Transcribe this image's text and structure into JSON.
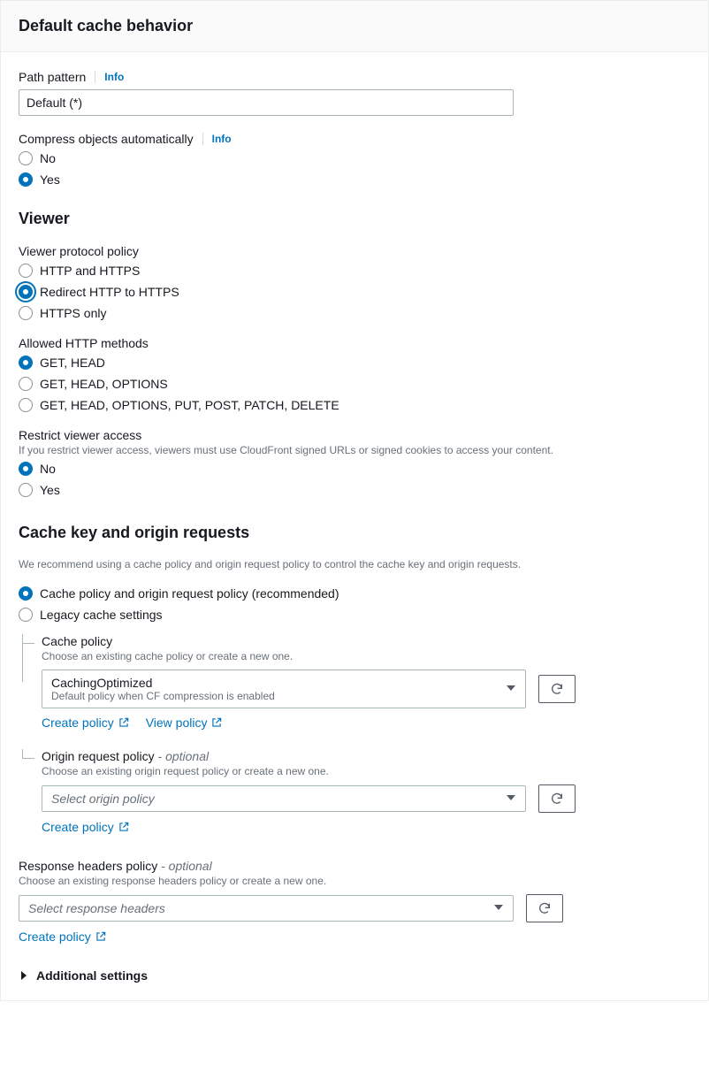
{
  "header": {
    "title": "Default cache behavior"
  },
  "info_label": "Info",
  "path_pattern": {
    "label": "Path pattern",
    "value": "Default (*)"
  },
  "compress": {
    "label": "Compress objects automatically",
    "options": [
      "No",
      "Yes"
    ],
    "selected": "Yes"
  },
  "viewer_heading": "Viewer",
  "viewer_protocol": {
    "label": "Viewer protocol policy",
    "options": [
      "HTTP and HTTPS",
      "Redirect HTTP to HTTPS",
      "HTTPS only"
    ],
    "selected": "Redirect HTTP to HTTPS"
  },
  "allowed_methods": {
    "label": "Allowed HTTP methods",
    "options": [
      "GET, HEAD",
      "GET, HEAD, OPTIONS",
      "GET, HEAD, OPTIONS, PUT, POST, PATCH, DELETE"
    ],
    "selected": "GET, HEAD"
  },
  "restrict_access": {
    "label": "Restrict viewer access",
    "helper": "If you restrict viewer access, viewers must use CloudFront signed URLs or signed cookies to access your content.",
    "options": [
      "No",
      "Yes"
    ],
    "selected": "No"
  },
  "cache_section": {
    "heading": "Cache key and origin requests",
    "helper": "We recommend using a cache policy and origin request policy to control the cache key and origin requests.",
    "mode": {
      "options": [
        "Cache policy and origin request policy (recommended)",
        "Legacy cache settings"
      ],
      "selected": "Cache policy and origin request policy (recommended)"
    },
    "cache_policy": {
      "label": "Cache policy",
      "helper": "Choose an existing cache policy or create a new one.",
      "value": "CachingOptimized",
      "sub": "Default policy when CF compression is enabled",
      "create_link": "Create policy",
      "view_link": "View policy"
    },
    "origin_policy": {
      "label": "Origin request policy",
      "optional": "- optional",
      "helper": "Choose an existing origin request policy or create a new one.",
      "placeholder": "Select origin policy",
      "create_link": "Create policy"
    }
  },
  "response_headers": {
    "label": "Response headers policy",
    "optional": "- optional",
    "helper": "Choose an existing response headers policy or create a new one.",
    "placeholder": "Select response headers",
    "create_link": "Create policy"
  },
  "additional_settings": "Additional settings"
}
